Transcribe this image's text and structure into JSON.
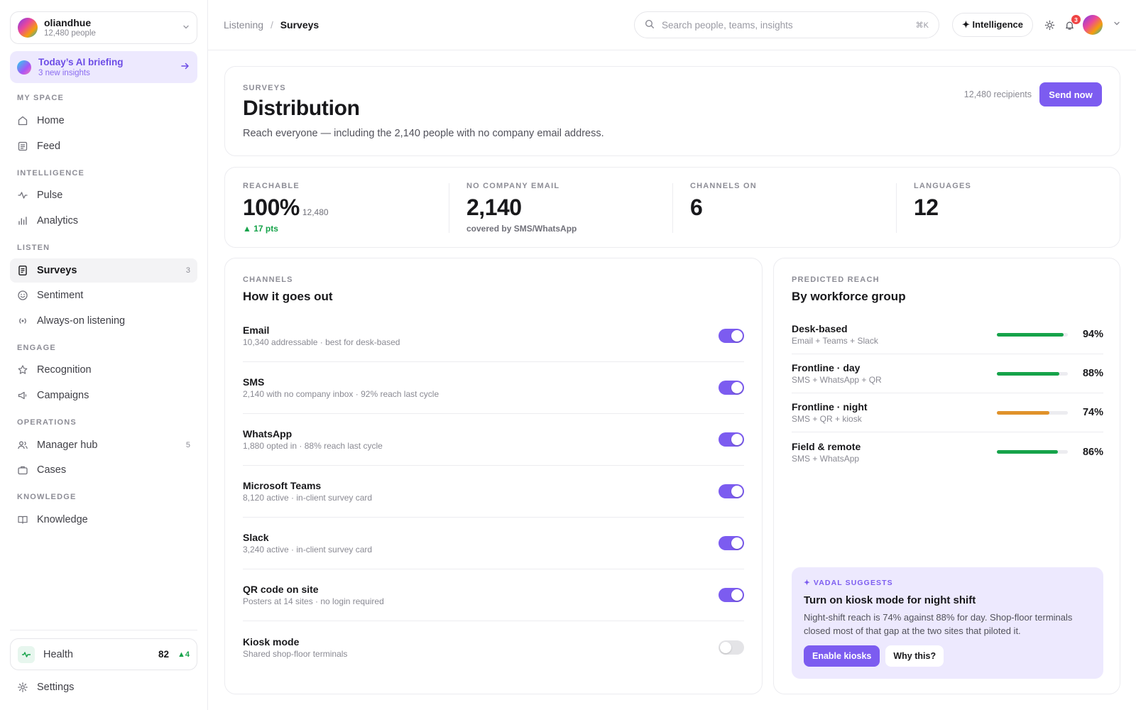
{
  "org": {
    "name": "oliandhue",
    "people": "12,480 people"
  },
  "briefing": {
    "title": "Today’s AI briefing",
    "subtitle": "3 new insights"
  },
  "sidebar": {
    "sections": {
      "my_space": "MY SPACE",
      "intelligence": "INTELLIGENCE",
      "listen": "LISTEN",
      "engage": "ENGAGE",
      "operations": "OPERATIONS",
      "knowledge": "KNOWLEDGE"
    },
    "items": {
      "home": "Home",
      "feed": "Feed",
      "pulse": "Pulse",
      "analytics": "Analytics",
      "surveys": "Surveys",
      "surveys_count": "3",
      "sentiment": "Sentiment",
      "always_on": "Always-on listening",
      "recognition": "Recognition",
      "campaigns": "Campaigns",
      "manager_hub": "Manager hub",
      "manager_hub_count": "5",
      "cases": "Cases",
      "knowledge": "Knowledge"
    },
    "health": {
      "label": "Health",
      "score": "82",
      "delta": "▲4"
    },
    "settings": "Settings"
  },
  "topbar": {
    "breadcrumb": [
      "Listening",
      "Surveys"
    ],
    "search_placeholder": "Search people, teams, insights",
    "search_shortcut": "⌘K",
    "intelligence_label": "✦ Intelligence",
    "notifications_count": "3"
  },
  "hero": {
    "eyebrow": "SURVEYS",
    "title": "Distribution",
    "description": "Reach everyone — including the 2,140 people with no company email address.",
    "recipients": "12,480 recipients",
    "send_label": "Send now"
  },
  "stats": [
    {
      "label": "REACHABLE",
      "value": "100%",
      "suffix": "12,480",
      "delta": "▲ 17 pts"
    },
    {
      "label": "NO COMPANY EMAIL",
      "value": "2,140",
      "note": "covered by SMS/WhatsApp"
    },
    {
      "label": "CHANNELS ON",
      "value": "6"
    },
    {
      "label": "LANGUAGES",
      "value": "12"
    }
  ],
  "channels": {
    "eyebrow": "CHANNELS",
    "title": "How it goes out",
    "items": [
      {
        "name": "Email",
        "detail": "10,340 addressable · best for desk-based",
        "on": true
      },
      {
        "name": "SMS",
        "detail": "2,140 with no company inbox · 92% reach last cycle",
        "on": true
      },
      {
        "name": "WhatsApp",
        "detail": "1,880 opted in · 88% reach last cycle",
        "on": true
      },
      {
        "name": "Microsoft Teams",
        "detail": "8,120 active · in-client survey card",
        "on": true
      },
      {
        "name": "Slack",
        "detail": "3,240 active · in-client survey card",
        "on": true
      },
      {
        "name": "QR code on site",
        "detail": "Posters at 14 sites · no login required",
        "on": true
      },
      {
        "name": "Kiosk mode",
        "detail": "Shared shop-floor terminals",
        "on": false
      }
    ]
  },
  "reach": {
    "eyebrow": "PREDICTED REACH",
    "title": "By workforce group",
    "groups": [
      {
        "name": "Desk-based",
        "channels": "Email + Teams + Slack",
        "percent": 94,
        "label": "94%",
        "color": "#16a34a"
      },
      {
        "name": "Frontline · day",
        "channels": "SMS + WhatsApp + QR",
        "percent": 88,
        "label": "88%",
        "color": "#16a34a"
      },
      {
        "name": "Frontline · night",
        "channels": "SMS + QR + kiosk",
        "percent": 74,
        "label": "74%",
        "color": "#e0922a"
      },
      {
        "name": "Field & remote",
        "channels": "SMS + WhatsApp",
        "percent": 86,
        "label": "86%",
        "color": "#16a34a"
      }
    ]
  },
  "suggestion": {
    "eyebrow": "✦ VADAL SUGGESTS",
    "title": "Turn on kiosk mode for night shift",
    "body": "Night-shift reach is 74% against 88% for day. Shop-floor terminals closed most of that gap at the two sites that piloted it.",
    "primary_label": "Enable kiosks",
    "secondary_label": "Why this?"
  },
  "colors": {
    "accent": "#7c5cf0",
    "success": "#16a34a",
    "warning": "#e0922a",
    "danger": "#ef4444"
  }
}
